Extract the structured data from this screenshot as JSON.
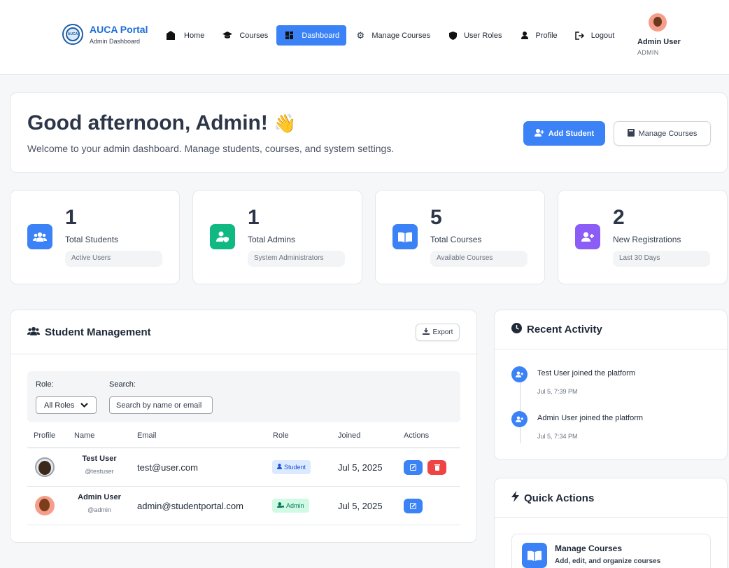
{
  "brand": {
    "title": "AUCA Portal",
    "subtitle": "Admin Dashboard",
    "logo_text": "AUCA"
  },
  "nav": [
    {
      "label": "Home",
      "icon": "home-icon"
    },
    {
      "label": "Courses",
      "icon": "graduation-cap-icon"
    },
    {
      "label": "Dashboard",
      "icon": "dashboard-icon",
      "active": true
    },
    {
      "label": "Manage Courses",
      "icon": "gear-icon"
    },
    {
      "label": "User Roles",
      "icon": "shield-icon"
    },
    {
      "label": "Profile",
      "icon": "user-icon"
    },
    {
      "label": "Logout",
      "icon": "logout-icon"
    }
  ],
  "user": {
    "name": "Admin User",
    "role": "ADMIN"
  },
  "welcome": {
    "greeting": "Good afternoon, Admin!",
    "emoji": "👋",
    "subtitle": "Welcome to your admin dashboard. Manage students, courses, and system settings.",
    "add_student_label": "Add Student",
    "manage_courses_label": "Manage Courses"
  },
  "stats": [
    {
      "value": "1",
      "label": "Total Students",
      "note": "Active Users",
      "color": "#3b82f6",
      "icon": "users-icon"
    },
    {
      "value": "1",
      "label": "Total Admins",
      "note": "System Administrators",
      "color": "#10b981",
      "icon": "user-shield-icon"
    },
    {
      "value": "5",
      "label": "Total Courses",
      "note": "Available Courses",
      "color": "#3b82f6",
      "icon": "book-open-icon"
    },
    {
      "value": "2",
      "label": "New Registrations",
      "note": "Last 30 Days",
      "color": "#8b5cf6",
      "icon": "user-plus-icon"
    }
  ],
  "students": {
    "title": "Student Management",
    "export_label": "Export",
    "role_label": "Role:",
    "role_value": "All Roles",
    "search_label": "Search:",
    "search_placeholder": "Search by name or email",
    "columns": [
      "Profile",
      "Name",
      "Email",
      "Role",
      "Joined",
      "Actions"
    ],
    "rows": [
      {
        "name": "Test User",
        "username": "@testuser",
        "email": "test@user.com",
        "role": "Student",
        "joined": "Jul 5, 2025"
      },
      {
        "name": "Admin User",
        "username": "@admin",
        "email": "admin@studentportal.com",
        "role": "Admin",
        "joined": "Jul 5, 2025"
      }
    ]
  },
  "activity": {
    "title": "Recent Activity",
    "items": [
      {
        "text": "Test User joined the platform",
        "time": "Jul 5, 7:39 PM"
      },
      {
        "text": "Admin User joined the platform",
        "time": "Jul 5, 7:34 PM"
      }
    ]
  },
  "quick": {
    "title": "Quick Actions",
    "items": [
      {
        "title": "Manage Courses",
        "subtitle": "Add, edit, and organize courses"
      }
    ]
  }
}
